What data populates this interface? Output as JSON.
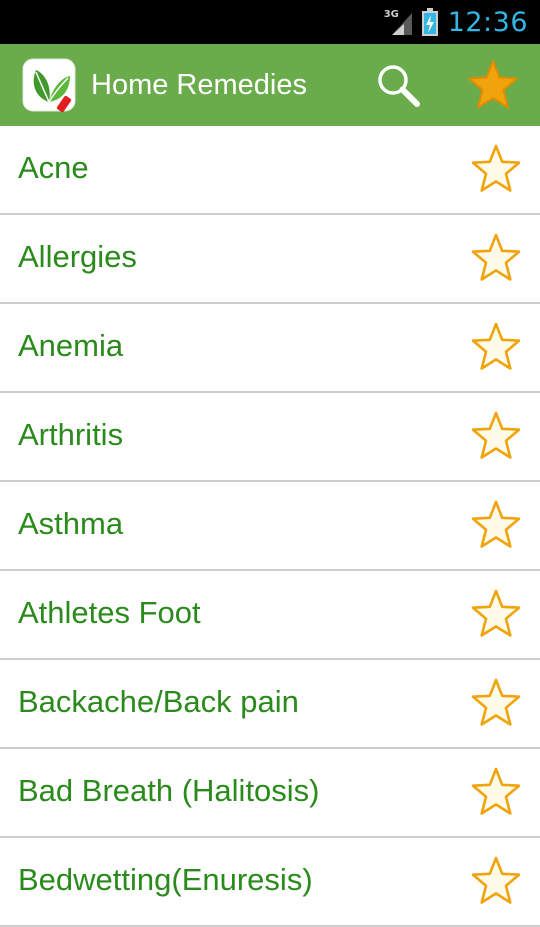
{
  "status_bar": {
    "network": "3G",
    "time": "12:36",
    "colors": {
      "time": "#33b5e5",
      "background": "#000000"
    },
    "icons": [
      "signal-icon",
      "battery-charging-icon"
    ]
  },
  "action_bar": {
    "title": "Home Remedies",
    "background": "#6aab4b",
    "icons": [
      "app-logo-icon",
      "search-icon",
      "favorites-star-icon"
    ]
  },
  "list": {
    "label_color": "#2b8a1c",
    "star_color": "#f0a30a",
    "items": [
      {
        "label": "Acne",
        "favorite": false
      },
      {
        "label": "Allergies",
        "favorite": false
      },
      {
        "label": "Anemia",
        "favorite": false
      },
      {
        "label": "Arthritis",
        "favorite": false
      },
      {
        "label": "Asthma",
        "favorite": false
      },
      {
        "label": "Athletes Foot",
        "favorite": false
      },
      {
        "label": "Backache/Back pain",
        "favorite": false
      },
      {
        "label": "Bad Breath (Halitosis)",
        "favorite": false
      },
      {
        "label": "Bedwetting(Enuresis)",
        "favorite": false
      }
    ]
  }
}
